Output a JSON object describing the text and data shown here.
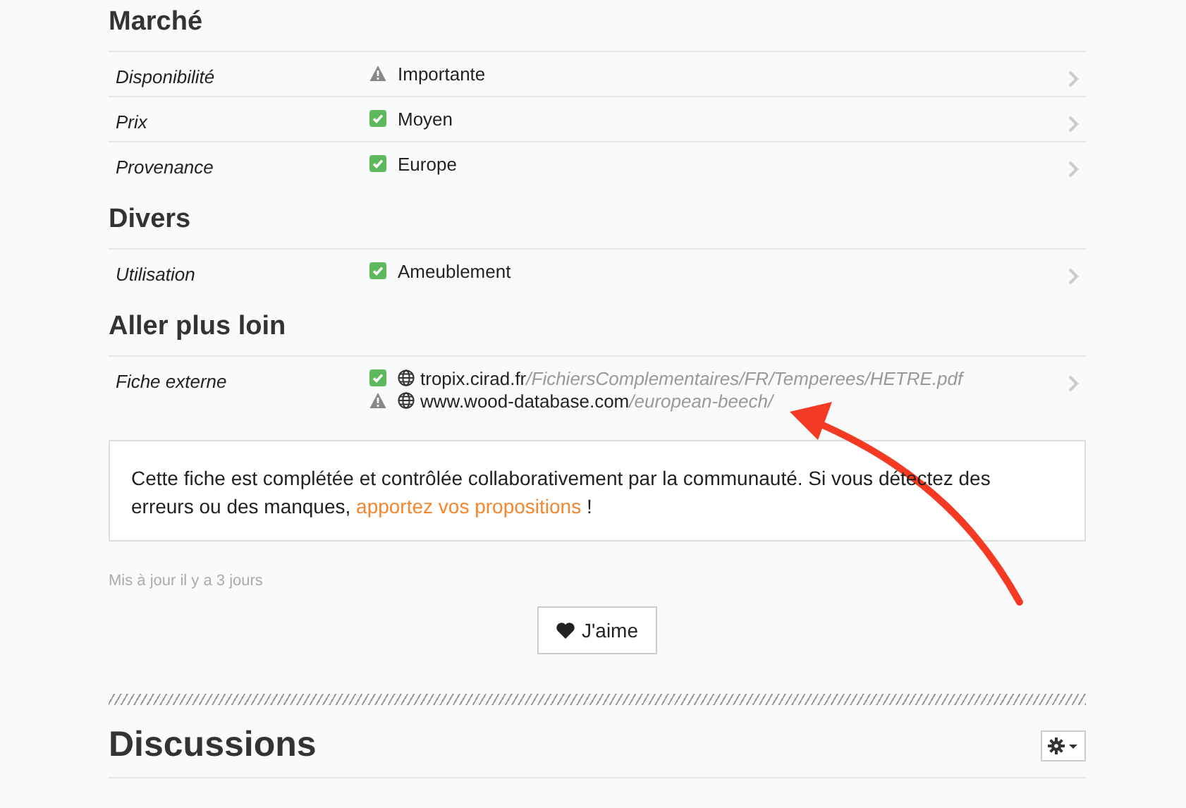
{
  "sections": [
    {
      "title": "Marché",
      "rows": [
        {
          "label": "Disponibilité",
          "values": [
            {
              "warning": true,
              "kind": "text",
              "text": "Importante"
            }
          ]
        },
        {
          "label": "Prix",
          "values": [
            {
              "warning": false,
              "kind": "text",
              "text": "Moyen"
            }
          ]
        },
        {
          "label": "Provenance",
          "values": [
            {
              "warning": false,
              "kind": "text",
              "text": "Europe"
            }
          ]
        }
      ]
    },
    {
      "title": "Divers",
      "rows": [
        {
          "label": "Utilisation",
          "values": [
            {
              "warning": false,
              "kind": "text",
              "text": "Ameublement"
            }
          ]
        }
      ]
    },
    {
      "title": "Aller plus loin",
      "rows": [
        {
          "label": "Fiche externe",
          "values": [
            {
              "warning": false,
              "kind": "link",
              "domain": "tropix.cirad.fr",
              "path": "/FichiersComplementaires/FR/Temperees/HETRE.pdf"
            },
            {
              "warning": true,
              "kind": "link",
              "domain": "www.wood-database.com",
              "path": "/european-beech/"
            }
          ]
        }
      ]
    }
  ],
  "notice": {
    "text_before": "Cette fiche est complétée et contrôlée collaborativement par la communauté. Si vous détectez des erreurs ou des manques,",
    "link": "apportez vos propositions",
    "text_after": "!"
  },
  "updated": "Mis à jour il y a 3 jours",
  "like_button": "J'aime",
  "discussions_title": "Discussions",
  "annotation_arrow": true
}
